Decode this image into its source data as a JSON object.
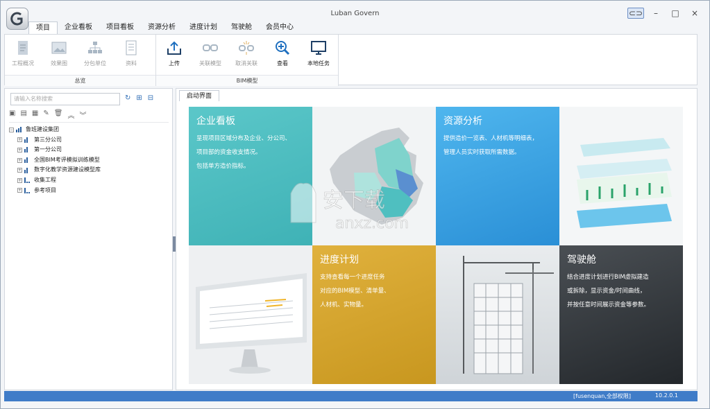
{
  "window": {
    "title": "Luban Govern"
  },
  "menu_tabs": [
    "项目",
    "企业看板",
    "项目看板",
    "资源分析",
    "进度计划",
    "驾驶舱",
    "会员中心"
  ],
  "ribbon": {
    "group1": {
      "label": "总览",
      "buttons": [
        "工程概况",
        "效果图",
        "分包单位",
        "资料"
      ]
    },
    "group2": {
      "label": "BIM模型",
      "buttons": [
        "上传",
        "关联模型",
        "取消关联",
        "查看",
        "本地任务"
      ]
    }
  },
  "search": {
    "placeholder": "请输入名称搜索"
  },
  "tree": {
    "root": "鲁班建设集团",
    "children": [
      "第三分公司",
      "第一分公司",
      "全国BIM考评模拟训练模型",
      "数字化教学资源建设模型库",
      "收集工程",
      "参考项目"
    ]
  },
  "content_tab": "启动界面",
  "tiles": {
    "qiye": {
      "title": "企业看板",
      "desc": [
        "呈现项目区域分布及企业、分公司、",
        "项目部的资金收支情况。",
        "包括单方造价指标。"
      ]
    },
    "ziyuan": {
      "title": "资源分析",
      "desc": [
        "提供造价一览表、人材机等明细表，",
        "管理人员实时获取所需数据。"
      ]
    },
    "jindu": {
      "title": "进度计划",
      "desc": [
        "支持查看每一个进度任务",
        "对应的BIM模型、清单量、",
        "人材机、实物量。"
      ]
    },
    "jiashi": {
      "title": "驾驶舱",
      "desc": [
        "结合进度计划进行BIM虚拟建造",
        "或拆除，显示资金/时间曲线，",
        "并按任意时间展示资金等参数。"
      ]
    }
  },
  "watermark": {
    "text": "安下载",
    "domain": "anxz.com"
  },
  "status": {
    "user": "[fusenquan,全部权限]",
    "version": "10.2.0.1"
  }
}
